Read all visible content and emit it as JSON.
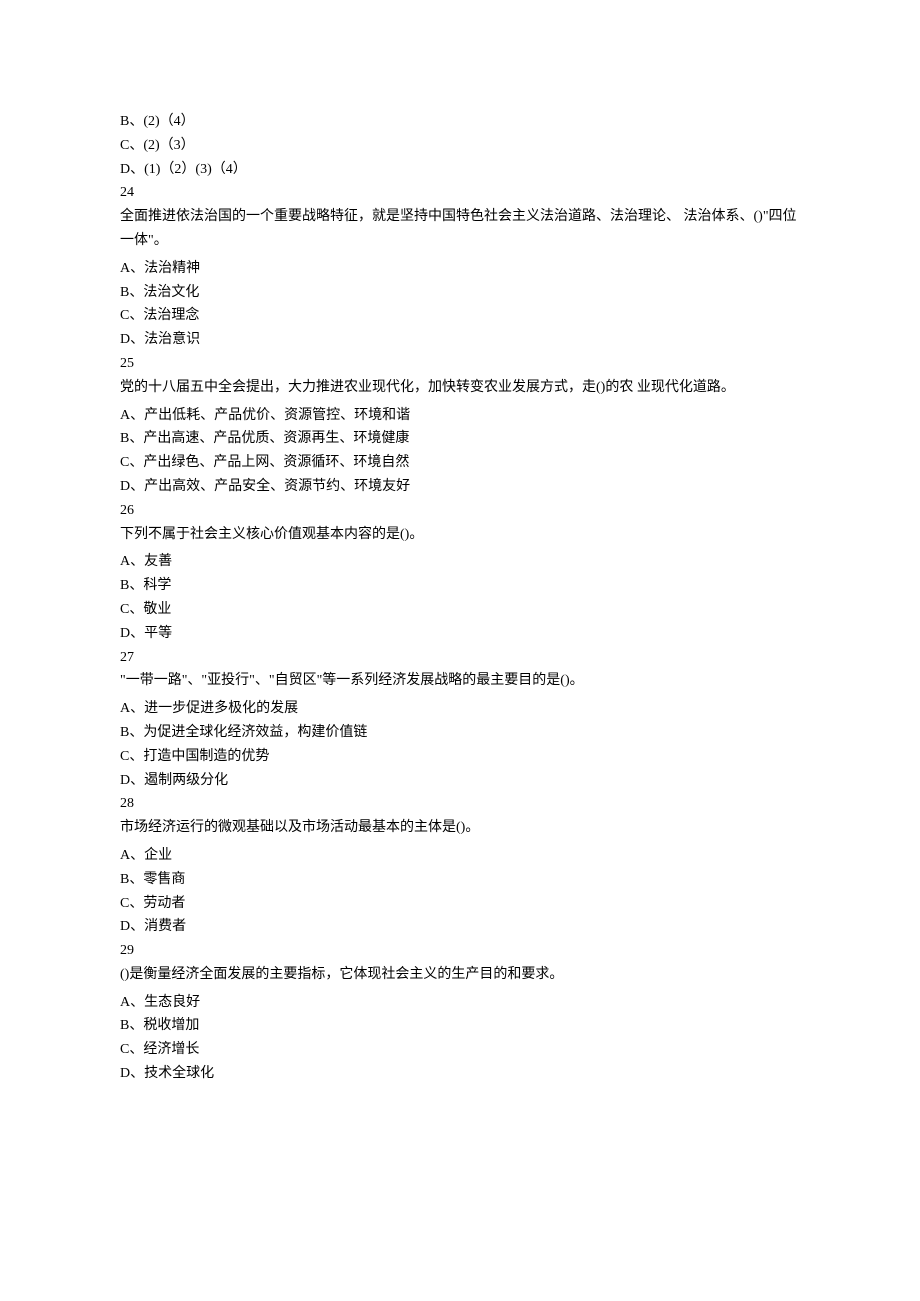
{
  "questions": [
    {
      "num": null,
      "text": null,
      "options": [
        "B、(2)（4）",
        "C、(2)（3）",
        "D、(1)（2）(3)（4）"
      ]
    },
    {
      "num": "24",
      "text": "全面推进依法治国的一个重要战略特征，就是坚持中国特色社会主义法治道路、法治理论、 法治体系、()\"四位一体\"。",
      "options": [
        "A、法治精神",
        "B、法治文化",
        "C、法治理念",
        "D、法治意识"
      ]
    },
    {
      "num": "25",
      "text": "党的十八届五中全会提出，大力推进农业现代化，加快转变农业发展方式，走()的农 业现代化道路。",
      "options": [
        "A、产出低耗、产品优价、资源管控、环境和谐",
        "B、产出高速、产品优质、资源再生、环境健康",
        "C、产出绿色、产品上网、资源循环、环境自然",
        "D、产出高效、产品安全、资源节约、环境友好"
      ]
    },
    {
      "num": "26",
      "text": "下列不属于社会主义核心价值观基本内容的是()。",
      "options": [
        "A、友善",
        "B、科学",
        "C、敬业",
        "D、平等"
      ]
    },
    {
      "num": "27",
      "text": "\"一带一路\"、\"亚投行\"、\"自贸区\"等一系列经济发展战略的最主要目的是()。",
      "options": [
        "A、进一步促进多极化的发展",
        "B、为促进全球化经济效益，构建价值链",
        "C、打造中国制造的优势",
        "D、遏制两级分化"
      ]
    },
    {
      "num": "28",
      "text": "市场经济运行的微观基础以及市场活动最基本的主体是()。",
      "options": [
        "A、企业",
        "B、零售商",
        "C、劳动者",
        "D、消费者"
      ]
    },
    {
      "num": "29",
      "text": "()是衡量经济全面发展的主要指标，它体现社会主义的生产目的和要求。",
      "options": [
        "A、生态良好",
        "B、税收增加",
        "C、经济增长",
        "D、技术全球化"
      ]
    }
  ]
}
